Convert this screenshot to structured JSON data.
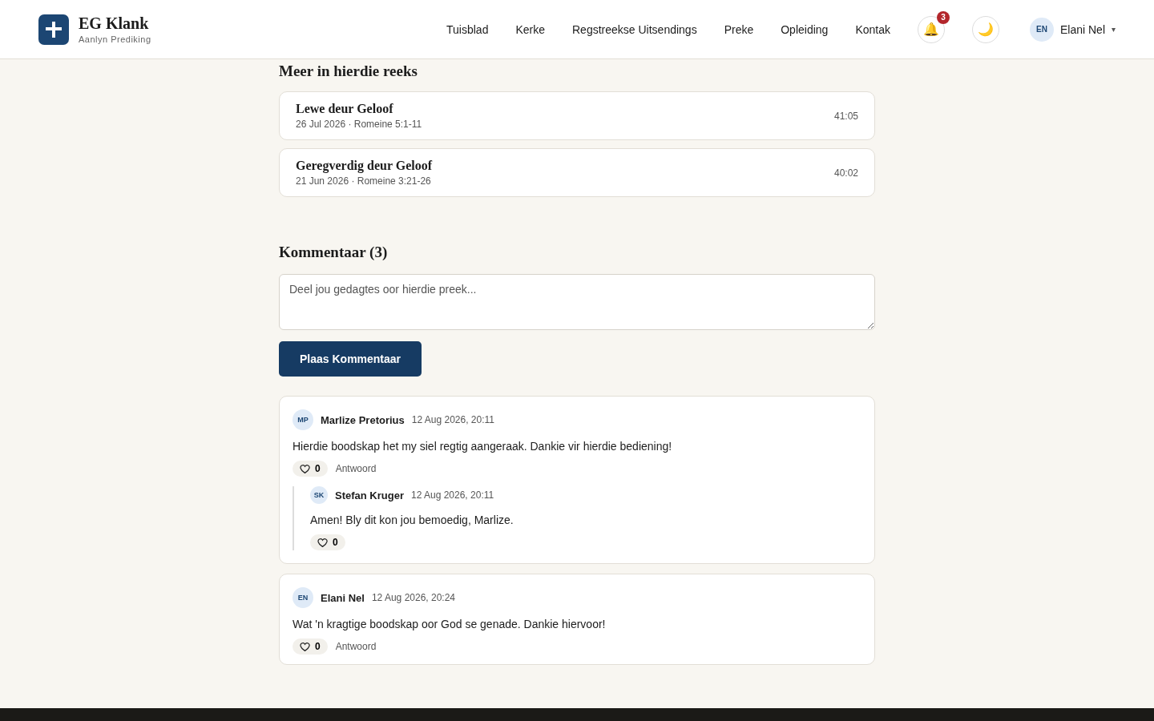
{
  "brand": {
    "title": "EG Klank",
    "subtitle": "Aanlyn Prediking"
  },
  "nav": [
    {
      "label": "Tuisblad",
      "selected": false
    },
    {
      "label": "Kerke",
      "selected": false
    },
    {
      "label": "Regstreekse Uitsendings",
      "selected": false
    },
    {
      "label": "Preke",
      "selected": false
    },
    {
      "label": "Opleiding",
      "selected": false
    },
    {
      "label": "Kontak",
      "selected": false
    }
  ],
  "notifications": {
    "icon": "🔔",
    "count": "3"
  },
  "theme_toggle": {
    "icon": "🌙"
  },
  "user": {
    "initials": "EN",
    "name": "Elani Nel",
    "caret": "▾"
  },
  "series": {
    "title": "Meer in hierdie reeks",
    "items": [
      {
        "title": "Lewe deur Geloof",
        "meta": "26 Jul 2026 · Romeine 5:1-11",
        "duration": "41:05"
      },
      {
        "title": "Geregverdig deur Geloof",
        "meta": "21 Jun 2026 · Romeine 3:21-26",
        "duration": "40:02"
      }
    ]
  },
  "comments": {
    "title": "Kommentaar (3)",
    "placeholder": "Deel jou gedagtes oor hierdie preek...",
    "submit": "Plaas Kommentaar",
    "items": [
      {
        "initials": "MP",
        "author": "Marlize Pretorius",
        "time": "12 Aug 2026, 20:11",
        "text": "Hierdie boodskap het my siel regtig aangeraak. Dankie vir hierdie bediening!",
        "likes": "0",
        "reply": "Antwoord",
        "children": [
          {
            "initials": "SK",
            "author": "Stefan Kruger",
            "time": "12 Aug 2026, 20:11",
            "text": "Amen! Bly dit kon jou bemoedig, Marlize.",
            "likes": "0"
          }
        ]
      },
      {
        "initials": "EN",
        "author": "Elani Nel",
        "time": "12 Aug 2026, 20:24",
        "text": "Wat 'n kragtige boodskap oor God se genade. Dankie hiervoor!",
        "likes": "0",
        "reply": "Antwoord"
      }
    ]
  }
}
